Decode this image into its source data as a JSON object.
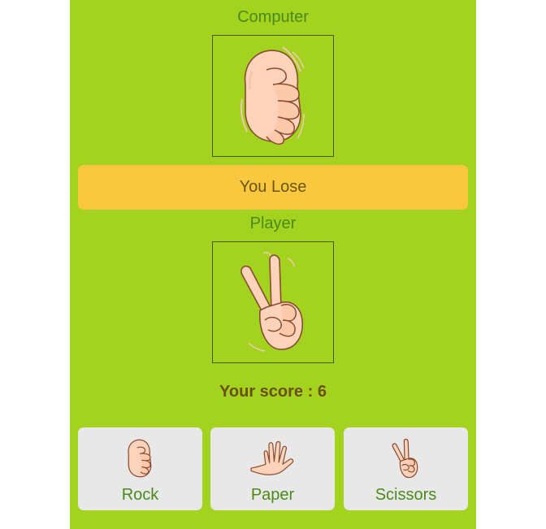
{
  "computer": {
    "label": "Computer",
    "choice": "rock"
  },
  "result": {
    "text": "You Lose"
  },
  "player": {
    "label": "Player",
    "choice": "scissors"
  },
  "score": {
    "text": "Your score : 6"
  },
  "choices": [
    {
      "label": "Rock",
      "icon": "rock-hand-icon"
    },
    {
      "label": "Paper",
      "icon": "paper-hand-icon"
    },
    {
      "label": "Scissors",
      "icon": "scissors-hand-icon"
    }
  ],
  "colors": {
    "background": "#a3d21f",
    "banner": "#f9c83f",
    "button": "#e8e8e8",
    "label": "#4a8a1a",
    "score": "#6b4f12"
  }
}
